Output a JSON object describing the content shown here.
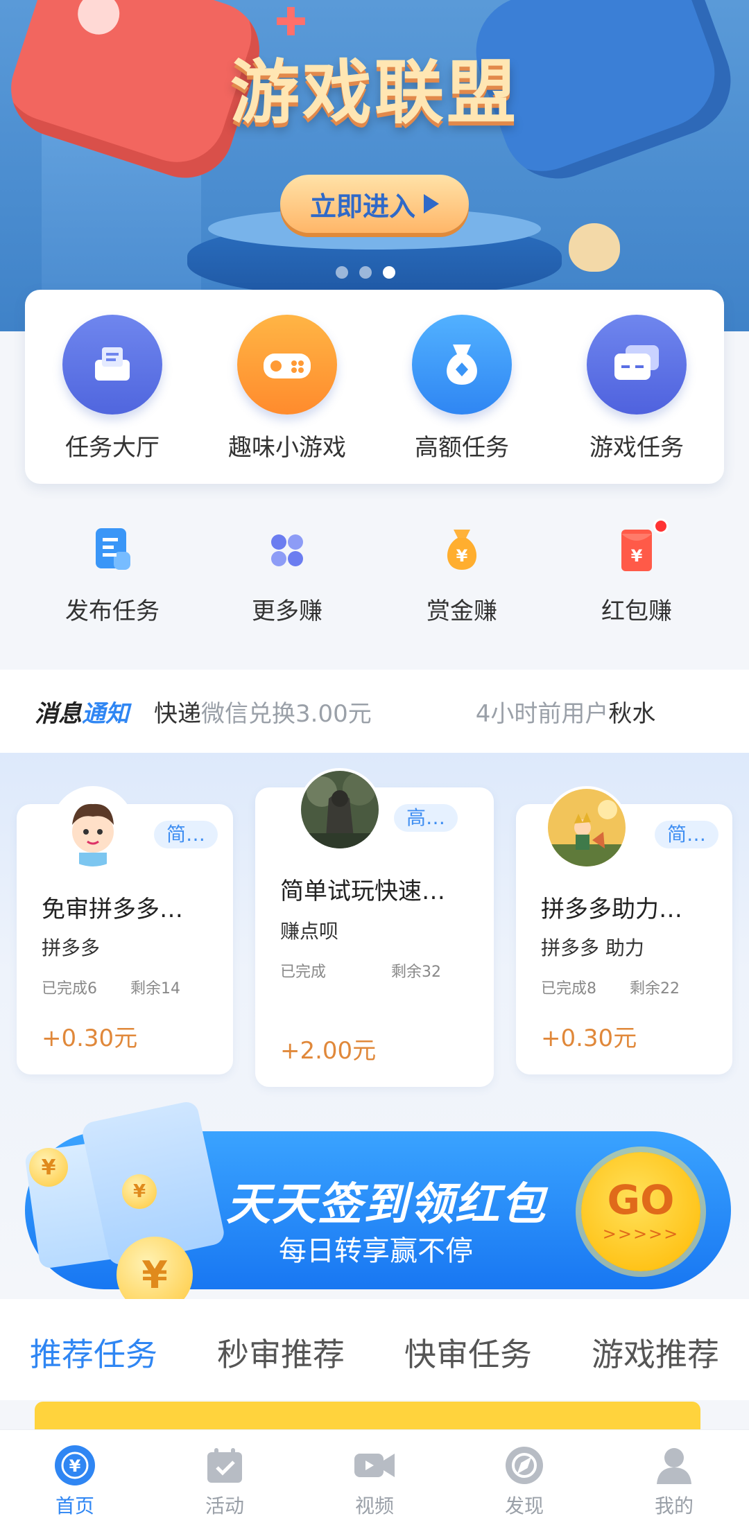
{
  "banner": {
    "title": "游戏联盟",
    "button_label": "立即进入",
    "dots": 3,
    "active_dot": 2
  },
  "main_grid": [
    {
      "label": "任务大厅",
      "icon": "inbox-tray-icon"
    },
    {
      "label": "趣味小游戏",
      "icon": "game-controller-icon"
    },
    {
      "label": "高额任务",
      "icon": "money-bag-icon"
    },
    {
      "label": "游戏任务",
      "icon": "gamepad-chat-icon"
    }
  ],
  "secondary_grid": [
    {
      "label": "发布任务",
      "icon": "document-icon"
    },
    {
      "label": "更多赚",
      "icon": "four-dots-icon"
    },
    {
      "label": "赏金赚",
      "icon": "yuan-bag-icon"
    },
    {
      "label": "红包赚",
      "icon": "red-envelope-icon",
      "has_badge": true
    }
  ],
  "notice": {
    "tag_part1": "消息",
    "tag_part2": "通知",
    "text1": "快递",
    "text2": "微信兑换3.00元",
    "text3": "4小时前用户",
    "text4": "秋水"
  },
  "tasks": [
    {
      "badge": "简…",
      "title": "免审拼多多…",
      "subtitle": "拼多多",
      "completed": "已完成6",
      "remaining": "剩余14",
      "price": "+0.30元"
    },
    {
      "badge": "高…",
      "title": "简单试玩快速…",
      "subtitle": "赚点呗",
      "completed": "已完成",
      "remaining": "剩余32",
      "price": "+2.00元"
    },
    {
      "badge": "简…",
      "title": "拼多多助力…",
      "subtitle": "拼多多 助力",
      "completed": "已完成8",
      "remaining": "剩余22",
      "price": "+0.30元"
    }
  ],
  "sign_banner": {
    "title": "天天签到领红包",
    "subtitle": "每日转享赢不停",
    "go_label": "GO",
    "go_arrows": ">>>>>",
    "coin_symbol": "¥"
  },
  "tabs": [
    {
      "label": "推荐任务",
      "active": true
    },
    {
      "label": "秒审推荐",
      "active": false
    },
    {
      "label": "快审任务",
      "active": false
    },
    {
      "label": "游戏推荐",
      "active": false
    }
  ],
  "bottom_nav": [
    {
      "label": "首页",
      "icon": "home-yuan-icon",
      "active": true
    },
    {
      "label": "活动",
      "icon": "calendar-check-icon",
      "active": false
    },
    {
      "label": "视频",
      "icon": "video-camera-icon",
      "active": false
    },
    {
      "label": "发现",
      "icon": "compass-icon",
      "active": false
    },
    {
      "label": "我的",
      "icon": "user-icon",
      "active": false
    }
  ],
  "colors": {
    "accent": "#2f86f3",
    "price": "#e0883a",
    "badge_bg": "#e6f1ff"
  }
}
